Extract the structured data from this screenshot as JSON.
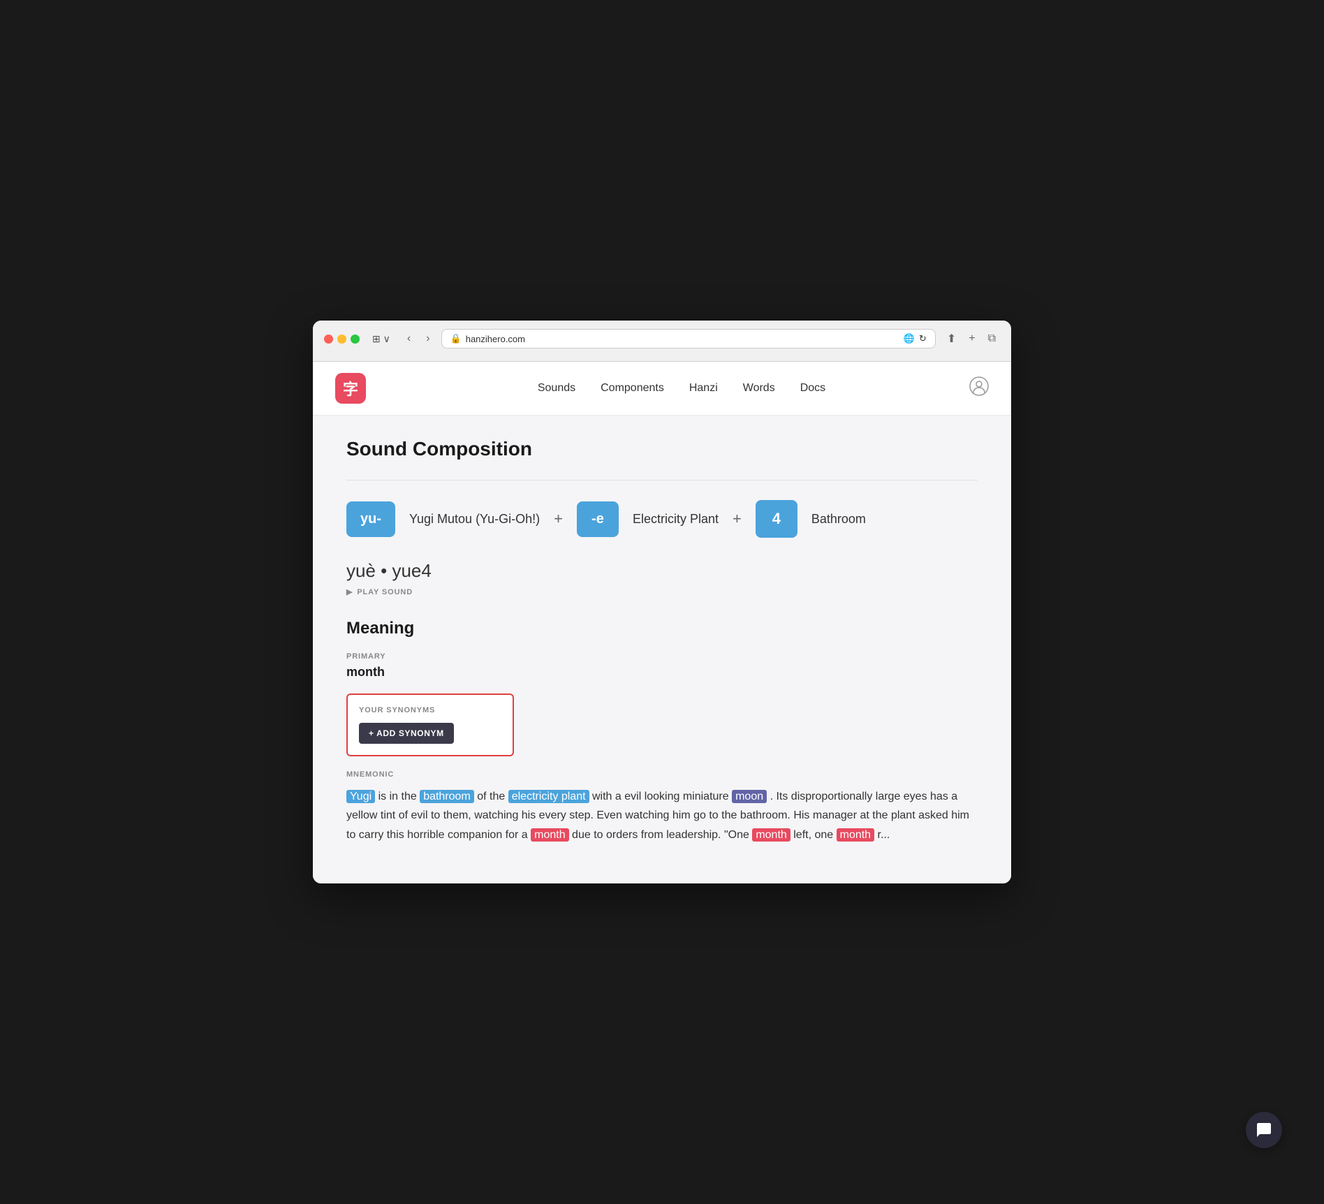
{
  "browser": {
    "url": "hanzihero.com",
    "lock_icon": "🔒",
    "translate_icon": "🌐",
    "reload_icon": "↻",
    "share_icon": "↑",
    "plus_icon": "+",
    "tabs_icon": "⧉",
    "back_icon": "‹",
    "forward_icon": "›",
    "sidebar_icon": "⊞"
  },
  "nav": {
    "logo_char": "字",
    "links": [
      "Sounds",
      "Components",
      "Hanzi",
      "Words",
      "Docs"
    ],
    "user_icon": "👤"
  },
  "page": {
    "section_title": "Sound Composition",
    "sound_parts": [
      {
        "token": "yu-",
        "label": "Yugi Mutou (Yu-Gi-Oh!)"
      },
      {
        "plus": "+"
      },
      {
        "token": "-e",
        "label": "Electricity Plant"
      },
      {
        "plus": "+"
      },
      {
        "token": "4",
        "label": "Bathroom"
      }
    ],
    "pronunciation": "yuè • yue4",
    "play_sound_label": "PLAY SOUND",
    "meaning_title": "Meaning",
    "primary_label": "PRIMARY",
    "primary_value": "month",
    "synonyms_label": "YOUR SYNONYMS",
    "add_synonym_label": "+ ADD SYNONYM",
    "mnemonic_label": "MNEMONIC",
    "mnemonic_parts": [
      {
        "text": "Yugi",
        "type": "highlight-blue"
      },
      {
        "text": " is in the ",
        "type": "plain"
      },
      {
        "text": "bathroom",
        "type": "highlight-blue"
      },
      {
        "text": " of the ",
        "type": "plain"
      },
      {
        "text": "electricity plant",
        "type": "highlight-blue"
      },
      {
        "text": " with a evil looking miniature ",
        "type": "plain"
      },
      {
        "text": "moon",
        "type": "highlight-purple"
      },
      {
        "text": ". Its disproportionally large eyes has a yellow tint of evil to them, watching his every step. Even watching him go to the bathroom. His manager at the plant asked him to carry this horrible companion for a ",
        "type": "plain"
      },
      {
        "text": "month",
        "type": "highlight-pink"
      },
      {
        "text": " due to orders from leadership. \"One ",
        "type": "plain"
      },
      {
        "text": "month",
        "type": "highlight-pink"
      },
      {
        "text": " left, one ",
        "type": "plain"
      },
      {
        "text": "month",
        "type": "highlight-pink"
      },
      {
        "text": " r...",
        "type": "plain"
      }
    ]
  }
}
